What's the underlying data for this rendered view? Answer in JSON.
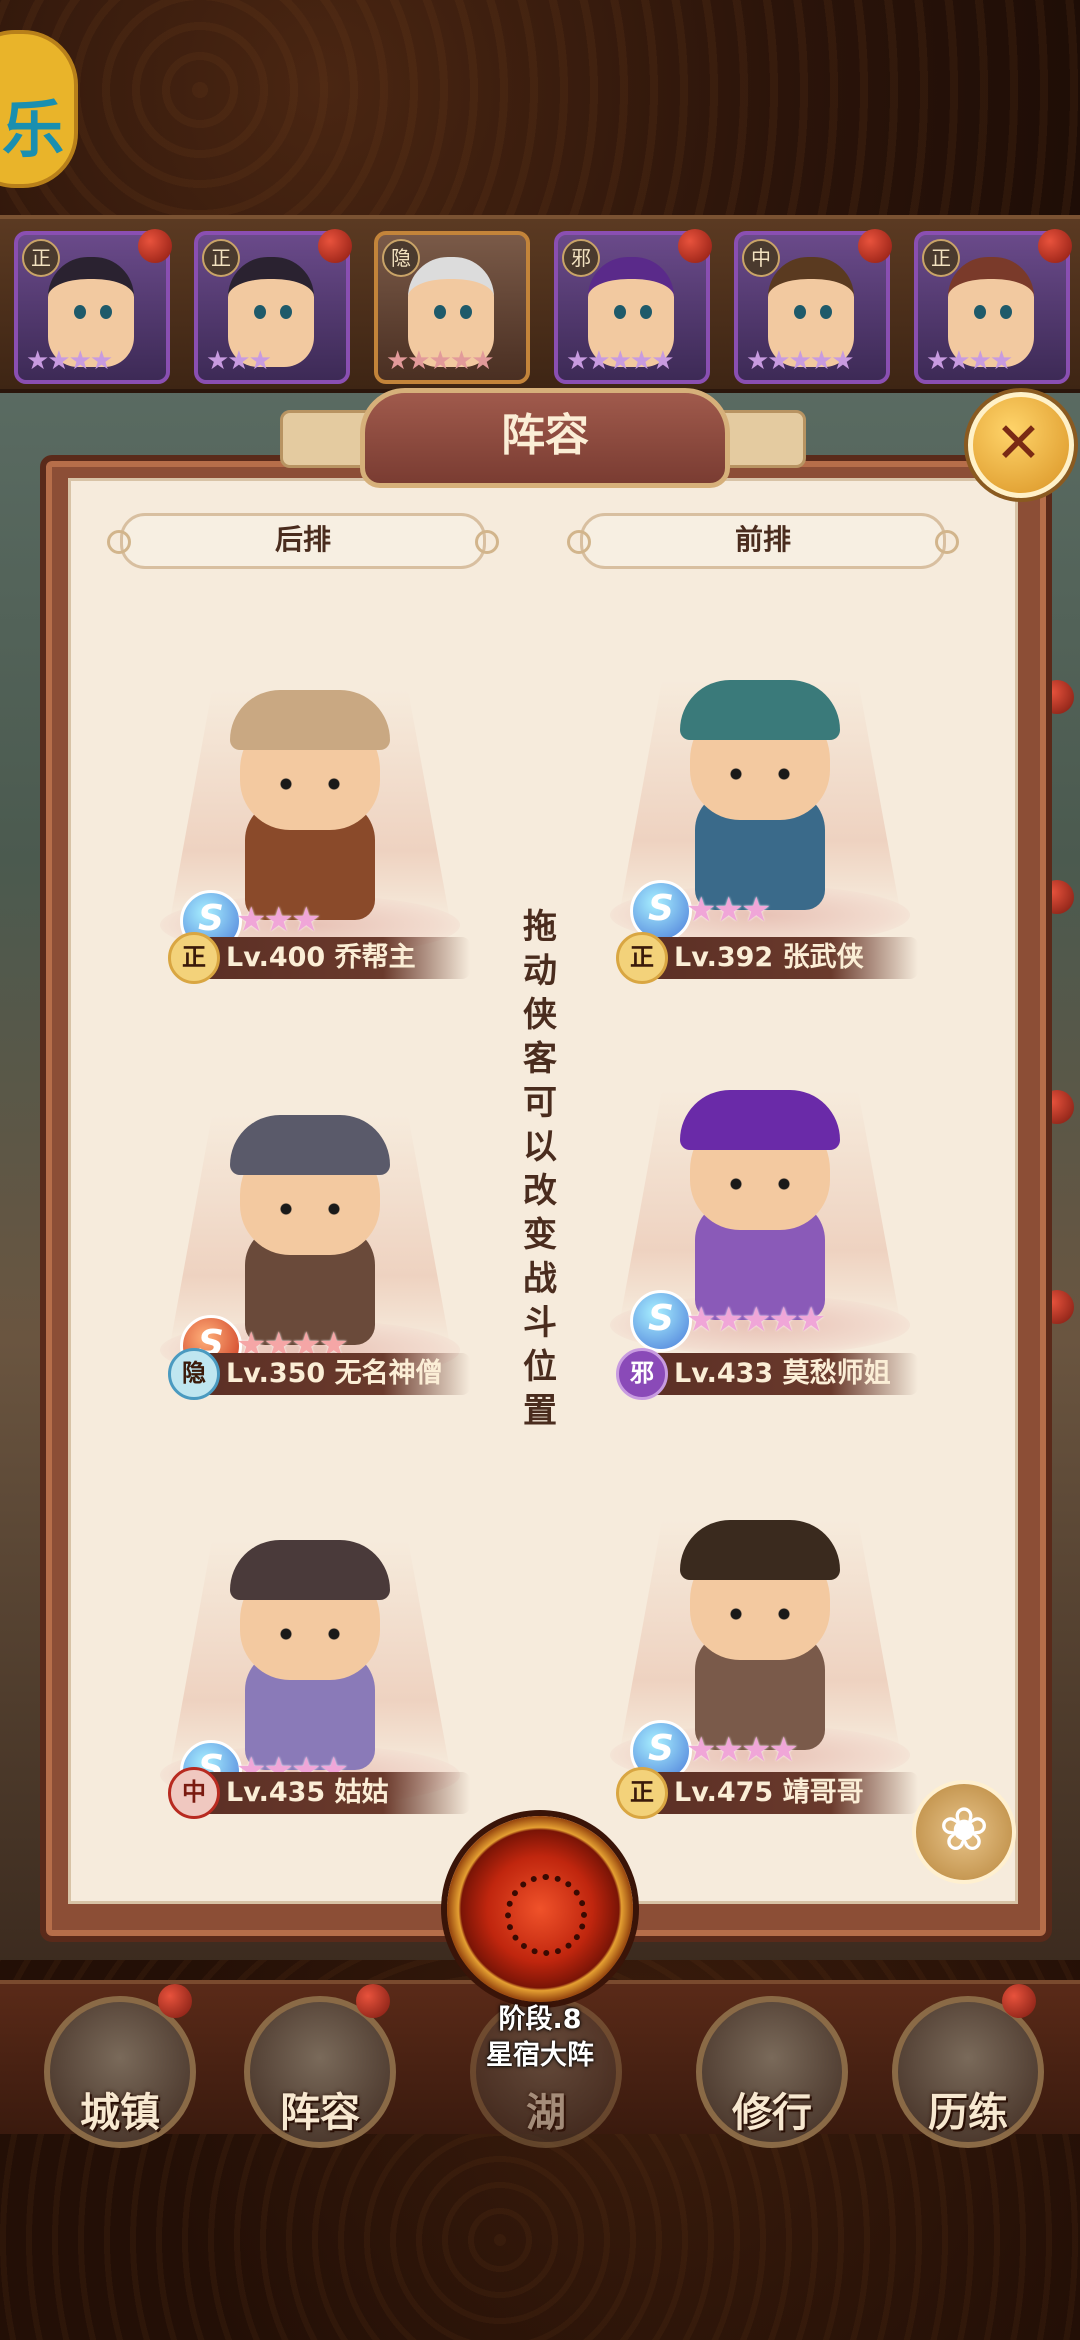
{
  "header": {
    "corner_logo_glyph": "乐"
  },
  "hero_strip": [
    {
      "faction": "正",
      "stars": "★★★★",
      "style": "purple"
    },
    {
      "faction": "正",
      "stars": "★★★",
      "style": "purple"
    },
    {
      "faction": "隐",
      "stars": "★★★★★",
      "style": "gold"
    },
    {
      "faction": "邪",
      "stars": "★★★★★",
      "style": "purple"
    },
    {
      "faction": "中",
      "stars": "★★★★★",
      "style": "purple"
    },
    {
      "faction": "正",
      "stars": "★★★★",
      "style": "purple"
    }
  ],
  "panel": {
    "title": "阵容",
    "back_row_label": "后排",
    "front_row_label": "前排",
    "hint": "拖动侠客可以改变战斗位置"
  },
  "slots": [
    {
      "faction": "正",
      "level_name": "Lv.400 乔帮主",
      "stars": "★★★",
      "badge": "S",
      "badge_style": "blue",
      "hat_color": "#c9a882",
      "body_color": "#8a4a2a"
    },
    {
      "faction": "正",
      "level_name": "Lv.392 张武侠",
      "stars": "★★★",
      "badge": "S",
      "badge_style": "blue",
      "hat_color": "#3a7a7a",
      "body_color": "#3a6a8a"
    },
    {
      "faction": "隐",
      "level_name": "Lv.350 无名神僧",
      "stars": "★★★★",
      "badge": "S",
      "badge_style": "red",
      "hat_color": "#5a5a6a",
      "body_color": "#6a4a3a"
    },
    {
      "faction": "邪",
      "level_name": "Lv.433 莫愁师姐",
      "stars": "★★★★★",
      "badge": "S",
      "badge_style": "blue",
      "hat_color": "#6a2aa8",
      "body_color": "#8a5ab8"
    },
    {
      "faction": "中",
      "level_name": "Lv.435 姑姑",
      "stars": "★★★★",
      "badge": "S",
      "badge_style": "blue",
      "hat_color": "#4a3a3a",
      "body_color": "#8a7ab8"
    },
    {
      "faction": "正",
      "level_name": "Lv.475 靖哥哥",
      "stars": "★★★★",
      "badge": "S",
      "badge_style": "blue",
      "hat_color": "#3a2a1e",
      "body_color": "#7a5a4a"
    }
  ],
  "formation": {
    "stage": "阶段.8",
    "name": "星宿大阵"
  },
  "nav": [
    {
      "label": "城镇"
    },
    {
      "label": "阵容"
    },
    {
      "label": "湖"
    },
    {
      "label": "修行"
    },
    {
      "label": "历练"
    }
  ],
  "colors": {
    "panel_bg": "#f6ebdc",
    "frame": "#8c4e36",
    "accent_gold": "#d99324"
  }
}
